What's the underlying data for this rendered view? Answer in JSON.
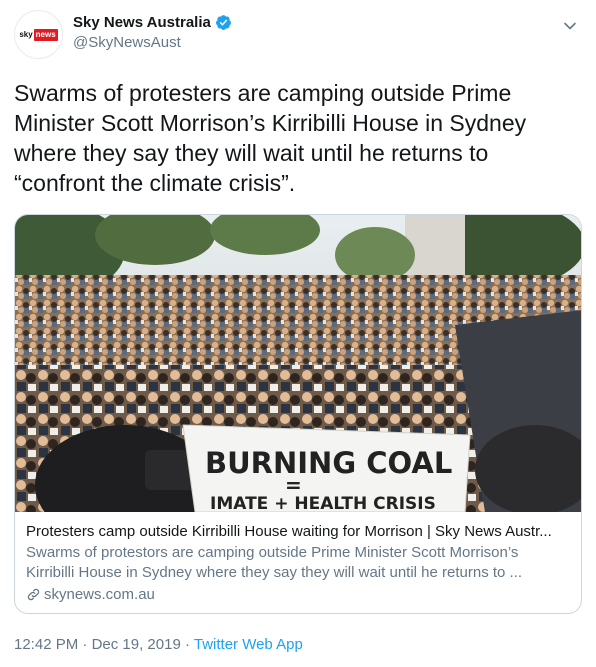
{
  "account": {
    "display_name": "Sky News Australia",
    "handle": "@SkyNewsAust",
    "logo_text_sky": "sky",
    "logo_text_news": "news"
  },
  "tweet": {
    "text": "Swarms of protesters are camping outside Prime Minister Scott Morrison’s Kirribilli House in Sydney where they say they will wait until he returns to “confront the climate crisis”."
  },
  "card": {
    "image_banner_line1": "BURNING COAL",
    "image_banner_eq": "=",
    "image_banner_line2": "IMATE + HEALTH CRISIS",
    "title": "Protesters camp outside Kirribilli House waiting for Morrison | Sky News Austr...",
    "description": "Swarms of protestors are camping outside Prime Minister Scott Morrison’s Kirribilli House in Sydney where they say they will wait until he returns to ...",
    "domain": "skynews.com.au"
  },
  "meta": {
    "time": "12:42 PM",
    "separator1": " · ",
    "date": "Dec 19, 2019",
    "separator2": " · ",
    "source": "Twitter Web App"
  },
  "colors": {
    "accent": "#1da1f2",
    "secondary_text": "#657786",
    "brand_red": "#e11b22"
  },
  "icons": [
    "verified-badge-icon",
    "chevron-down-icon",
    "link-icon"
  ]
}
